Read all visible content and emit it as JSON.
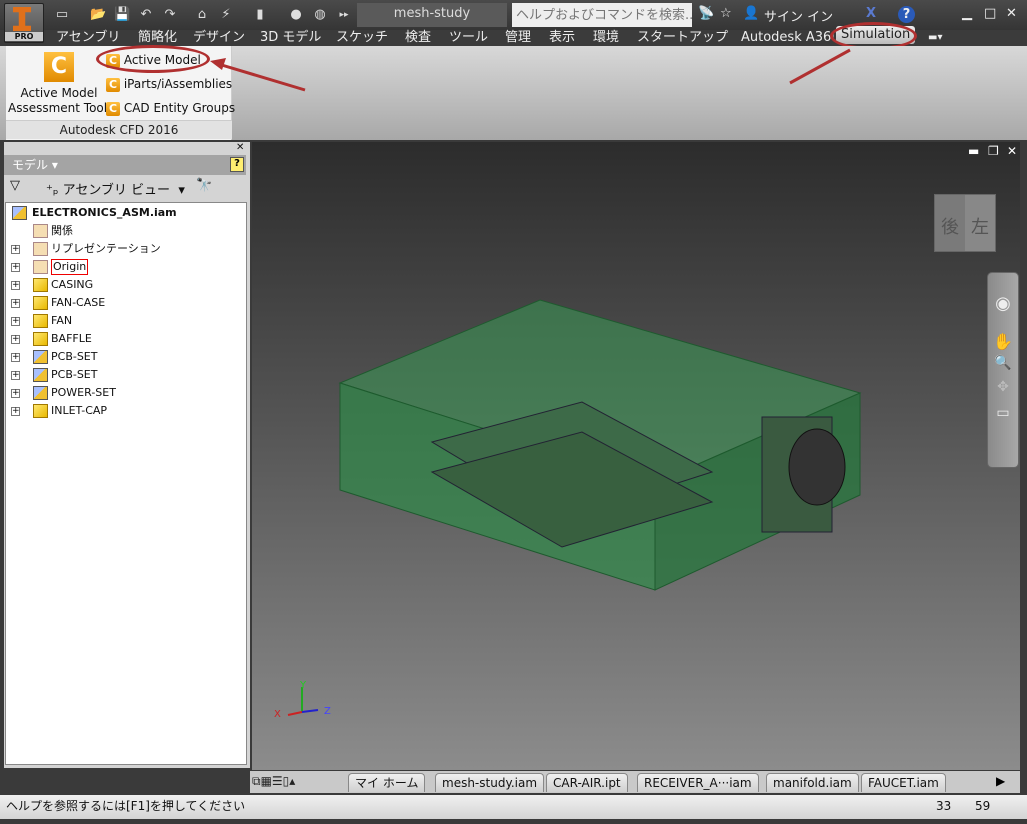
{
  "app": {
    "edition": "PRO",
    "document_title": "mesh-study"
  },
  "titlebar": {
    "search_placeholder": "ヘルプおよびコマンドを検索...",
    "sign_in": "サイン イン"
  },
  "menu_tabs": [
    "アセンブリ",
    "簡略化",
    "デザイン",
    "3D モデル",
    "スケッチ",
    "検査",
    "ツール",
    "管理",
    "表示",
    "環境",
    "スタートアップ",
    "Autodesk A360",
    "Simulation"
  ],
  "ribbon": {
    "big_button": "Active Model Assessment Tool",
    "big_button_line1": "Active Model",
    "big_button_line2": "Assessment Tool",
    "buttons": [
      "Active Model",
      "iParts/iAssemblies",
      "CAD Entity Groups"
    ],
    "panel_label": "Autodesk CFD 2016"
  },
  "browser": {
    "title": "モデル",
    "view": "アセンブリ ビュー",
    "root": "ELECTRONICS_ASM.iam",
    "nodes": [
      {
        "label": "関係",
        "icon": "folder",
        "expand": false
      },
      {
        "label": "リプレゼンテーション",
        "icon": "folder-rep",
        "expand": true
      },
      {
        "label": "Origin",
        "icon": "folder",
        "expand": true,
        "highlight": true
      },
      {
        "label": "CASING",
        "icon": "part-pinned",
        "expand": true
      },
      {
        "label": "FAN-CASE",
        "icon": "part",
        "expand": true
      },
      {
        "label": "FAN",
        "icon": "part",
        "expand": true
      },
      {
        "label": "BAFFLE",
        "icon": "part",
        "expand": true
      },
      {
        "label": "PCB-SET",
        "icon": "assembly",
        "expand": true
      },
      {
        "label": "PCB-SET",
        "icon": "assembly",
        "expand": true
      },
      {
        "label": "POWER-SET",
        "icon": "assembly",
        "expand": true
      },
      {
        "label": "INLET-CAP",
        "icon": "part",
        "expand": true
      }
    ]
  },
  "viewcube": {
    "back": "後",
    "left": "左"
  },
  "axes": {
    "x": "X",
    "y": "Y",
    "z": "Z"
  },
  "doc_tabs": [
    "マイ ホーム",
    "mesh-study.iam",
    "CAR-AIR.ipt",
    "RECEIVER_A···iam",
    "manifold.iam",
    "FAUCET.iam"
  ],
  "status": {
    "help": "ヘルプを参照するには[F1]を押してください",
    "n1": "33",
    "n2": "59"
  },
  "colors": {
    "model": "#2e8b46",
    "annotation": "#b03030",
    "accent": "#e0701a"
  }
}
